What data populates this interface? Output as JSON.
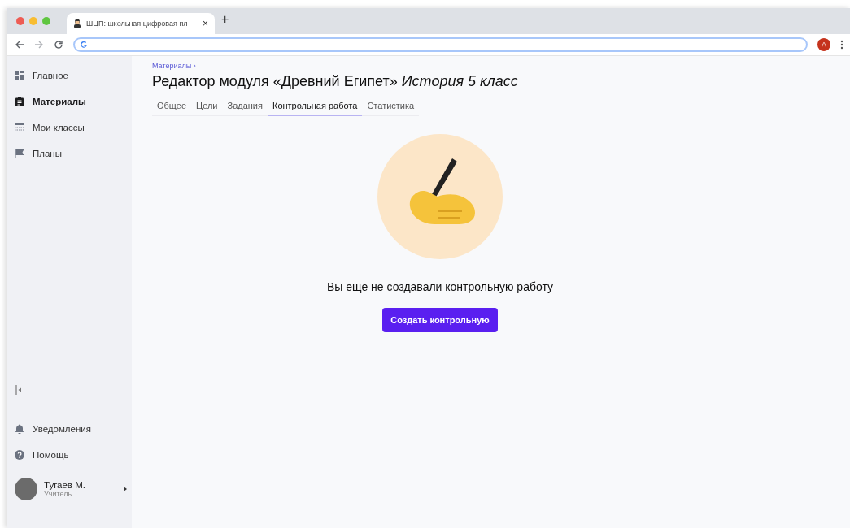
{
  "browser": {
    "tab_title": "ШЦП: школьная цифровая пл",
    "tab_close": "×",
    "new_tab": "+",
    "profile_initial": "А"
  },
  "sidebar": {
    "items": [
      {
        "label": "Главное",
        "kind": "grid",
        "selected": false
      },
      {
        "label": "Материалы",
        "kind": "clipboard",
        "selected": true
      },
      {
        "label": "Мои классы",
        "kind": "table",
        "selected": false
      },
      {
        "label": "Планы",
        "kind": "flag",
        "selected": false
      }
    ],
    "bottom_items": [
      {
        "label": "Уведомления",
        "kind": "bell"
      },
      {
        "label": "Помощь",
        "kind": "help"
      }
    ],
    "user": {
      "name": "Тугаев М.",
      "role": "Учитель"
    }
  },
  "breadcrumb": "Материалы ›",
  "title": "Редактор модуля «Древний Египет» *История 5 класс*",
  "tabs": [
    {
      "label": "Общее",
      "selected": false
    },
    {
      "label": "Цели",
      "selected": false
    },
    {
      "label": "Задания",
      "selected": false
    },
    {
      "label": "Контрольная работа",
      "selected": true
    },
    {
      "label": "Статистика",
      "selected": false
    }
  ],
  "empty_state": {
    "message": "Вы еще не создавали контрольную работу",
    "button": "Создать контрольную"
  }
}
